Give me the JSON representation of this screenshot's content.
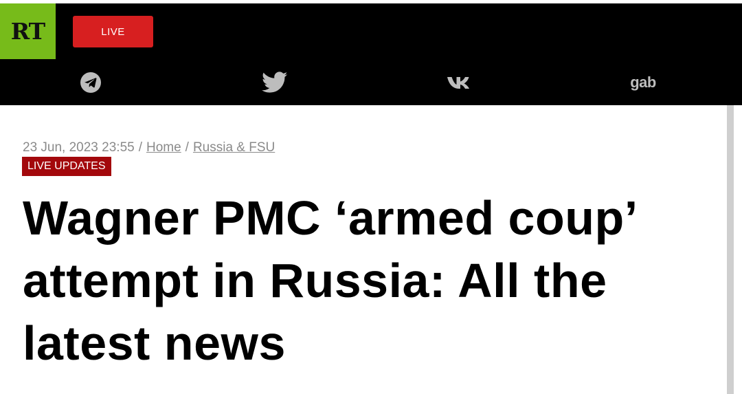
{
  "header": {
    "logo_text": "RT",
    "live_label": "LIVE",
    "colors": {
      "logo_bg": "#77bb1a",
      "live_bg": "#d71f20",
      "header_bg": "#000000"
    },
    "social": [
      {
        "name": "telegram-icon"
      },
      {
        "name": "twitter-icon"
      },
      {
        "name": "vk-icon"
      },
      {
        "name": "gab-icon",
        "label": "gab"
      }
    ]
  },
  "article": {
    "date": "23 Jun, 2023 23:55",
    "separator": "/",
    "breadcrumbs": [
      "Home",
      "Russia & FSU"
    ],
    "badge": "LIVE UPDATES",
    "badge_color": "#a3080c",
    "title": "Wagner PMC ‘armed coup’ attempt in Russia: All the latest news"
  }
}
